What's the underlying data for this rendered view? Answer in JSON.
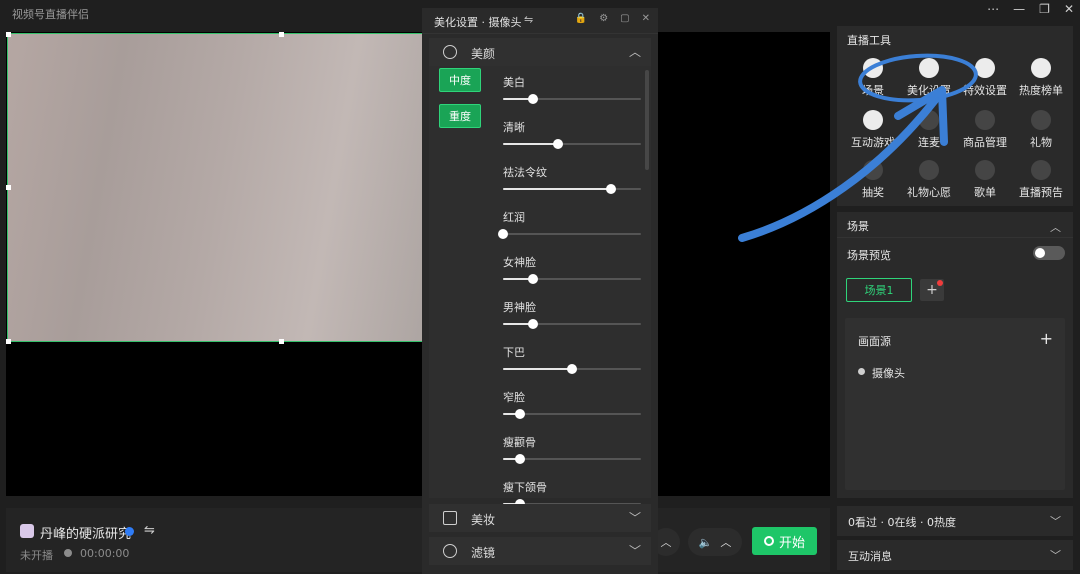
{
  "window": {
    "title": "视频号直播伴侣",
    "controls": [
      "⋯",
      "—",
      "❐",
      "✕"
    ]
  },
  "account": {
    "name": "丹峰的硬派研究",
    "switch_glyph": "⇋",
    "status": "未开播",
    "timer": "00:00:00"
  },
  "controls": {
    "chevron": "︿",
    "volume_glyph": "🔈",
    "start_label": "开始"
  },
  "beauty_panel": {
    "title": "美化设置 · 摄像头",
    "swap_glyph": "⇋",
    "header_icons": [
      "lock-icon",
      "gear-icon",
      "restore-icon",
      "close-icon"
    ],
    "sections": {
      "beauty": "美颜",
      "makeup": "美妆",
      "filter": "滤镜"
    },
    "levels": [
      "中度",
      "重度"
    ],
    "sliders": [
      {
        "label": "美白",
        "value": 0.22
      },
      {
        "label": "清晰",
        "value": 0.4
      },
      {
        "label": "祛法令纹",
        "value": 0.78
      },
      {
        "label": "红润",
        "value": 0.0
      },
      {
        "label": "女神脸",
        "value": 0.22
      },
      {
        "label": "男神脸",
        "value": 0.22
      },
      {
        "label": "下巴",
        "value": 0.5
      },
      {
        "label": "窄脸",
        "value": 0.12
      },
      {
        "label": "瘦颧骨",
        "value": 0.12
      },
      {
        "label": "瘦下颌骨",
        "value": 0.12
      }
    ]
  },
  "tools": {
    "title": "直播工具",
    "items": [
      {
        "label": "场景",
        "icon": "scene-icon"
      },
      {
        "label": "美化设置",
        "icon": "beauty-settings-icon"
      },
      {
        "label": "特效设置",
        "icon": "effects-icon"
      },
      {
        "label": "热度榜单",
        "icon": "ranking-icon"
      },
      {
        "label": "互动游戏",
        "icon": "game-icon"
      },
      {
        "label": "连麦",
        "icon": "phone-icon"
      },
      {
        "label": "商品管理",
        "icon": "shopping-bag-icon"
      },
      {
        "label": "礼物",
        "icon": "gift-icon"
      },
      {
        "label": "抽奖",
        "icon": "lottery-icon"
      },
      {
        "label": "礼物心愿",
        "icon": "wish-icon"
      },
      {
        "label": "歌单",
        "icon": "music-icon"
      },
      {
        "label": "直播预告",
        "icon": "preview-icon"
      }
    ]
  },
  "scene": {
    "title": "场景",
    "preview_label": "场景预览",
    "preview_on": false,
    "chip": "场景1",
    "sources_title": "画面源",
    "source_item": "摄像头"
  },
  "stats": {
    "text": "0看过 · 0在线 · 0热度"
  },
  "messages": {
    "title": "互动消息"
  },
  "colors": {
    "accent": "#1ec668",
    "annotation": "#3b7fd6"
  }
}
